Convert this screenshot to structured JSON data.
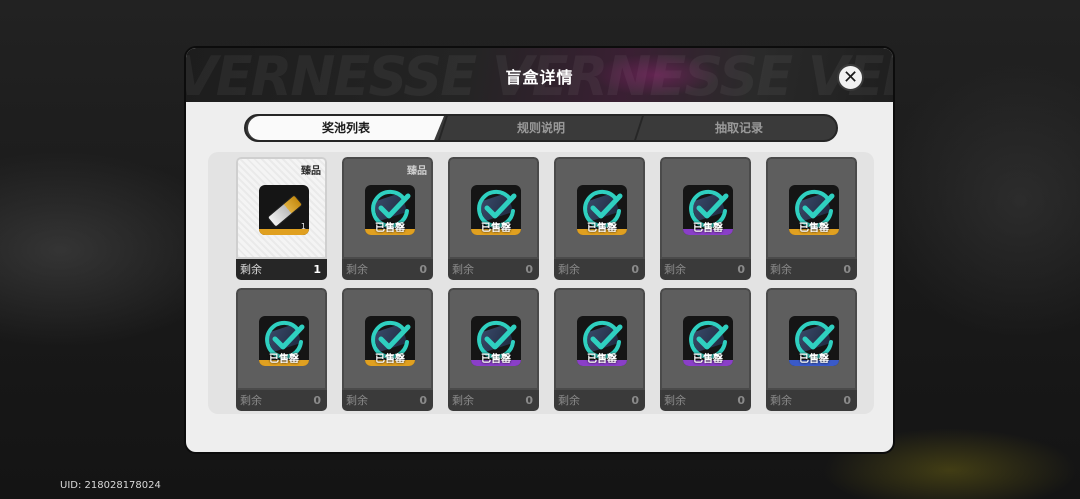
{
  "uid_text": "UID: 218028178024",
  "modal": {
    "title": "盲盒详情",
    "header_deco_text": "VERNESSE VERNESSE VERNESSE",
    "close_glyph": "✕"
  },
  "tabs": [
    {
      "label": "奖池列表",
      "active": true
    },
    {
      "label": "规则说明",
      "active": false
    },
    {
      "label": "抽取记录",
      "active": false
    }
  ],
  "remaining_label": "剩余",
  "soldout_label": "已售罄",
  "colors": {
    "teal_check": "#2fd0c0",
    "gold": "#e0a020",
    "purple": "#8a3fc8",
    "blue": "#3a5ac8"
  },
  "cards": [
    {
      "status": "available",
      "badge": "臻品",
      "remaining": "1",
      "qty": "1",
      "rarity_color": "#e0a020",
      "icon": "key-item-icon"
    },
    {
      "status": "soldout",
      "badge": "臻品",
      "remaining": "0",
      "qty": "",
      "rarity_color": "#e0a020",
      "icon": "soldout-check-icon"
    },
    {
      "status": "soldout",
      "badge": "",
      "remaining": "0",
      "qty": "",
      "rarity_color": "#e0a020",
      "icon": "soldout-check-icon"
    },
    {
      "status": "soldout",
      "badge": "",
      "remaining": "0",
      "qty": "",
      "rarity_color": "#e0a020",
      "icon": "soldout-check-icon"
    },
    {
      "status": "soldout",
      "badge": "",
      "remaining": "0",
      "qty": "",
      "rarity_color": "#8a3fc8",
      "icon": "soldout-check-icon"
    },
    {
      "status": "soldout",
      "badge": "",
      "remaining": "0",
      "qty": "",
      "rarity_color": "#e0a020",
      "icon": "soldout-check-icon"
    },
    {
      "status": "soldout",
      "badge": "",
      "remaining": "0",
      "qty": "",
      "rarity_color": "#e0a020",
      "icon": "soldout-check-icon"
    },
    {
      "status": "soldout",
      "badge": "",
      "remaining": "0",
      "qty": "",
      "rarity_color": "#e0a020",
      "icon": "soldout-check-icon"
    },
    {
      "status": "soldout",
      "badge": "",
      "remaining": "0",
      "qty": "",
      "rarity_color": "#8a3fc8",
      "icon": "soldout-check-icon"
    },
    {
      "status": "soldout",
      "badge": "",
      "remaining": "0",
      "qty": "",
      "rarity_color": "#8a3fc8",
      "icon": "soldout-check-icon"
    },
    {
      "status": "soldout",
      "badge": "",
      "remaining": "0",
      "qty": "",
      "rarity_color": "#8a3fc8",
      "icon": "soldout-check-icon"
    },
    {
      "status": "soldout",
      "badge": "",
      "remaining": "0",
      "qty": "",
      "rarity_color": "#3a5ac8",
      "icon": "soldout-check-icon"
    }
  ]
}
